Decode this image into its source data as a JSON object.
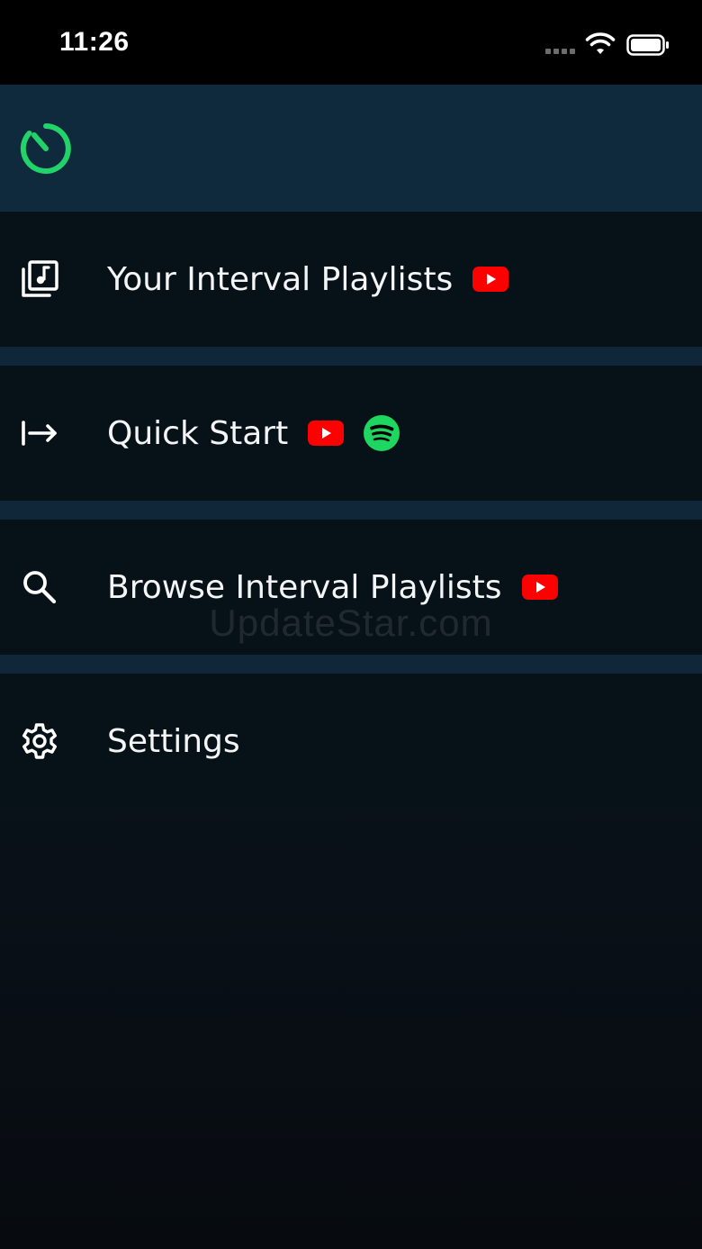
{
  "status_bar": {
    "time": "11:26",
    "icons": [
      "signal-icon",
      "wifi-icon",
      "battery-icon"
    ]
  },
  "header": {
    "logo": "timer-logo-icon"
  },
  "menu": {
    "items": [
      {
        "label": "Your Interval Playlists",
        "icon": "music-library-icon",
        "badges": [
          "youtube-icon"
        ]
      },
      {
        "label": "Quick Start",
        "icon": "arrow-right-to-line-icon",
        "badges": [
          "youtube-icon",
          "spotify-icon"
        ]
      },
      {
        "label": "Browse Interval Playlists",
        "icon": "search-icon",
        "badges": [
          "youtube-icon"
        ]
      },
      {
        "label": "Settings",
        "icon": "gear-icon",
        "badges": []
      }
    ]
  },
  "watermark": "UpdateStar.com",
  "colors": {
    "accent_green": "#22d36a",
    "youtube_red": "#ff0000",
    "spotify_green": "#1ed760",
    "header_bg": "#0e2a3c",
    "item_bg": "#071118"
  }
}
